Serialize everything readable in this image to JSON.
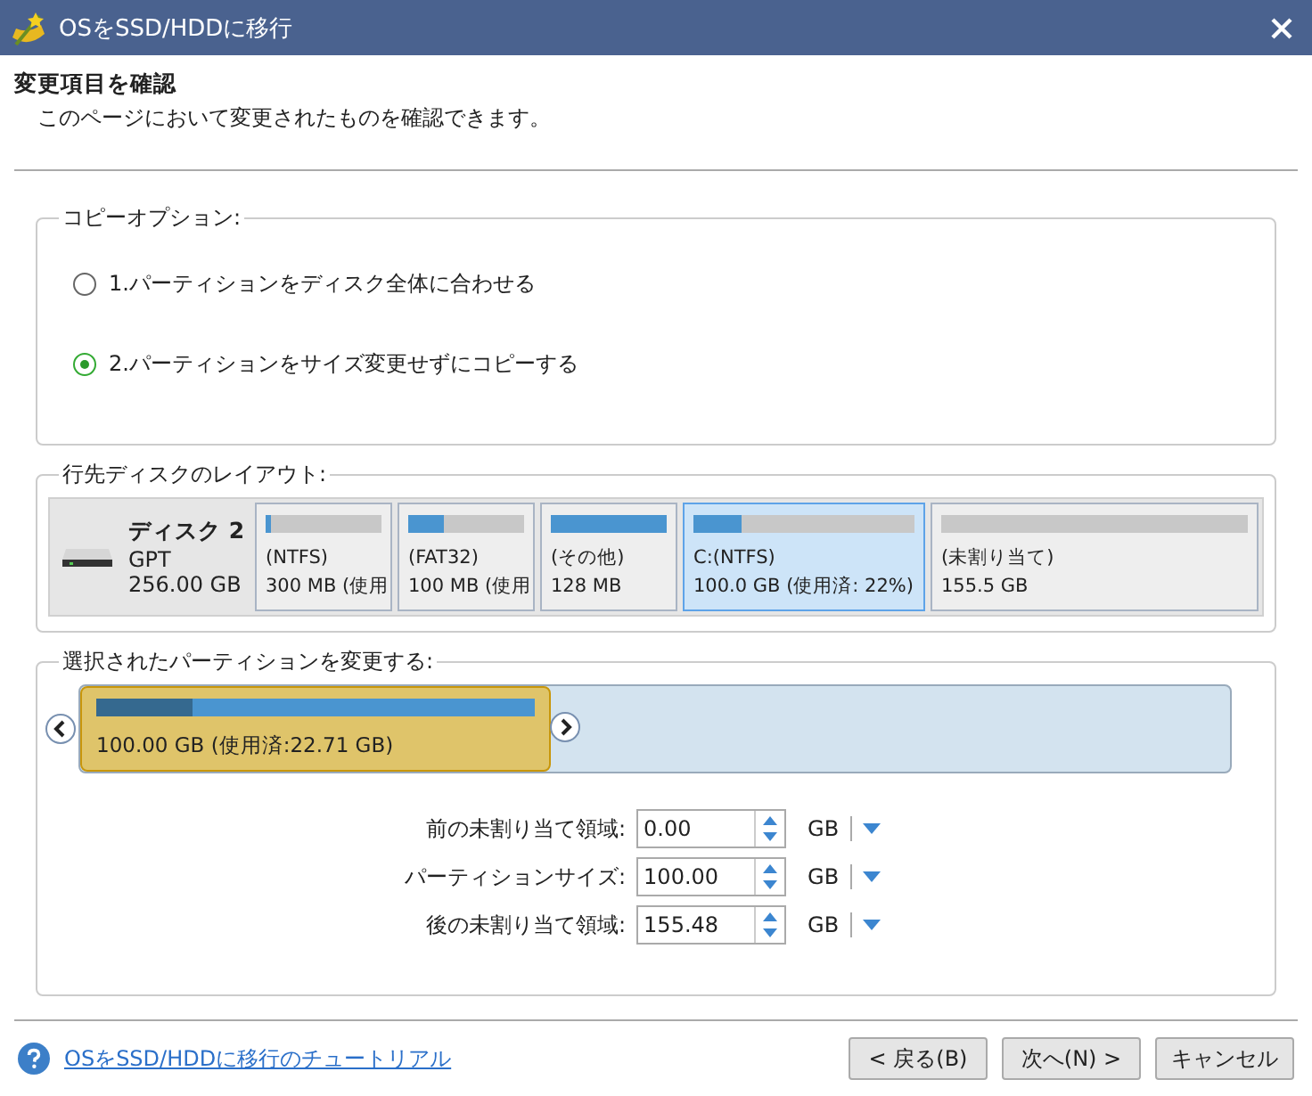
{
  "window": {
    "title": "OSをSSD/HDDに移行"
  },
  "header": {
    "title": "変更項目を確認",
    "subtitle": "このページにおいて変更されたものを確認できます。"
  },
  "copy_options": {
    "legend": "コピーオプション:",
    "options": [
      {
        "label": "1.パーティションをディスク全体に合わせる",
        "selected": false
      },
      {
        "label": "2.パーティションをサイズ変更せずにコピーする",
        "selected": true
      }
    ]
  },
  "disk_layout": {
    "legend": "行先ディスクのレイアウト:",
    "disk": {
      "name": "ディスク 2",
      "type": "GPT",
      "size": "256.00 GB"
    },
    "partitions": [
      {
        "name": "(NTFS)",
        "info": "300 MB (使用",
        "level": 0.04,
        "selected": false
      },
      {
        "name": "(FAT32)",
        "info": "100 MB (使用",
        "level": 0.3,
        "selected": false
      },
      {
        "name": "(その他)",
        "info": "128 MB",
        "level": 1,
        "selected": false
      },
      {
        "name": "C:(NTFS)",
        "info": "100.0 GB (使用済: 22%)",
        "level": 0.22,
        "selected": true
      },
      {
        "name": "(未割り当て)",
        "info": "155.5 GB",
        "selected": false
      }
    ]
  },
  "resize": {
    "legend": "選択されたパーティションを変更する:",
    "partition": {
      "label": "100.00 GB (使用済:22.71 GB)",
      "usage": {
        "level": 0.22
      }
    },
    "fields": [
      {
        "label": "前の未割り当て領域:",
        "value": "0.00",
        "unit": "GB"
      },
      {
        "label": "パーティションサイズ:",
        "value": "100.00",
        "unit": "GB"
      },
      {
        "label": "後の未割り当て領域:",
        "value": "155.48",
        "unit": "GB"
      }
    ]
  },
  "footer": {
    "help_link": "OSをSSD/HDDに移行のチュートリアル",
    "buttons": [
      "< 戻る(B)",
      "次へ(N) >",
      "キャンセル"
    ]
  }
}
